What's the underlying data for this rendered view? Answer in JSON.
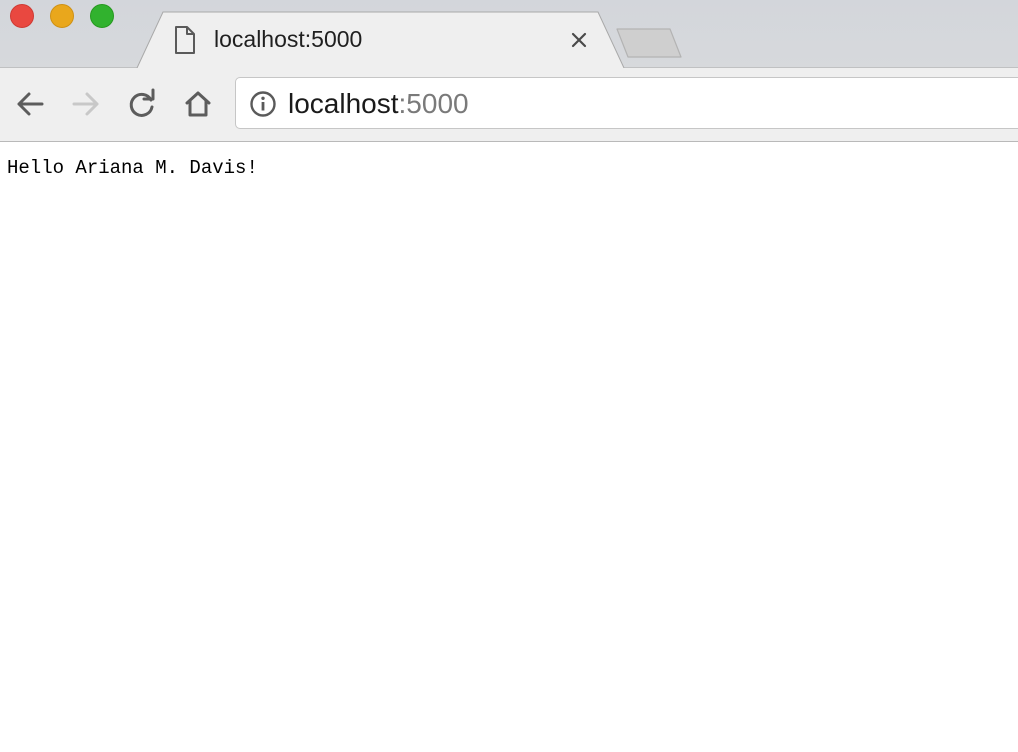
{
  "window": {
    "controls": [
      "close",
      "minimize",
      "maximize"
    ]
  },
  "tab": {
    "title": "localhost:5000",
    "icon": "page-icon",
    "close_icon": "close-icon"
  },
  "toolbar": {
    "buttons": [
      "back-icon",
      "forward-icon",
      "reload-icon",
      "home-icon"
    ],
    "address": {
      "icon": "info-icon",
      "host": "localhost",
      "port": ":5000"
    }
  },
  "page": {
    "text": "Hello Ariana M. Davis!"
  },
  "colors": {
    "close": "#e94840",
    "minimize": "#e9a71c",
    "maximize": "#31b22e",
    "forward_disabled": "#c8c8c8"
  }
}
